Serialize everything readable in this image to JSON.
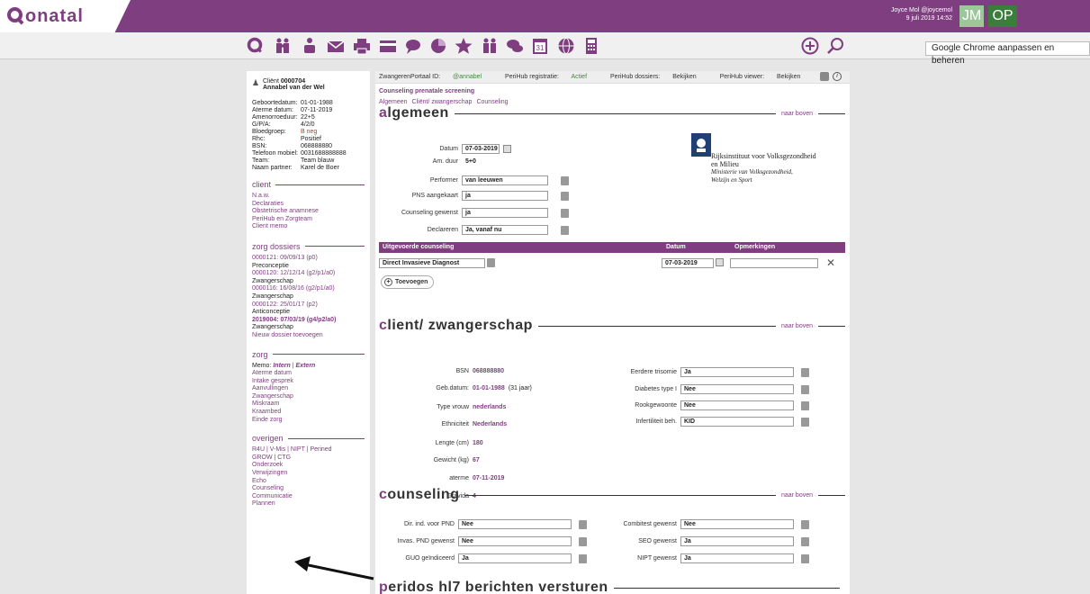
{
  "app": {
    "logo": "onatal"
  },
  "user": {
    "name": "Joyce Mol @joycemol",
    "datetime": "9 juli 2019 14:52",
    "avatar1": "JM",
    "avatar2": "OP"
  },
  "chrome_tooltip": "Google Chrome aanpassen en beheren",
  "toolbar": {
    "icons": [
      "search-icon",
      "family-icon",
      "baby-icon",
      "mail-icon",
      "print-icon",
      "card-icon",
      "chat-icon",
      "chart-icon",
      "star-icon",
      "family-icon",
      "conversation-icon",
      "calendar-icon",
      "globe-icon",
      "calculator-icon"
    ],
    "calendar_day": "31",
    "add": "+",
    "search": "search"
  },
  "sidebar": {
    "client_label": "Cliënt",
    "client_id": "0000704",
    "client_name": "Annabel van der Wel",
    "info": [
      [
        "Geboortedatum:",
        "01-01-1988"
      ],
      [
        "Aterme datum:",
        "07-11-2019"
      ],
      [
        "Amenorroeduur:",
        "22+5"
      ],
      [
        "G/P/A:",
        "4/2/0"
      ],
      [
        "Bloedgroep:",
        "B neg"
      ],
      [
        "Rhc:",
        "Positief"
      ],
      [
        "BSN:",
        "068888880"
      ],
      [
        "Telefoon mobiel:",
        "0031688888888"
      ],
      [
        "Team:",
        "Team blauw"
      ],
      [
        "Naam partner:",
        "Karel de Boer"
      ]
    ],
    "sec_client": "client",
    "client_links": [
      "N.a.w.",
      "Declaraties",
      "Obstetrische anamnese",
      "PeriHub en Zorgteam",
      "Client memo"
    ],
    "sec_dossiers": "zorg dossiers",
    "dossiers": [
      [
        "0000121: 09/09/13 (p0)",
        "Preconceptie"
      ],
      [
        "0000120: 12/12/14 (g2/p1/a0)",
        "Zwangerschap"
      ],
      [
        "0000116: 16/08/16 (g2/p1/a0)",
        "Zwangerschap"
      ],
      [
        "0000122: 25/01/17 (p2)",
        "Anticonceptie"
      ],
      [
        "2019004: 07/03/19 (g4/p2/a0)",
        "Zwangerschap"
      ]
    ],
    "new_dossier": "Nieuw dossier toevoegen",
    "sec_zorg": "zorg",
    "memo_label": "Memo:",
    "memo_intern": "Intern",
    "memo_sep": " | ",
    "memo_extern": "Extern",
    "zorg_links": [
      "Aterme datum",
      "Intake gesprek",
      "Aanvullingen",
      "Zwangerschap",
      "Miskraam",
      "Kraambed",
      "Einde zorg"
    ],
    "sec_overigen": "overigen",
    "overigen_links": [
      "R4U | V-Mis | NIPT | Perined",
      "GROW | CTG",
      "Onderzoek",
      "Verwijzingen",
      "Echo",
      "Counseling",
      "Communicatie",
      "Plannen"
    ]
  },
  "infobar": {
    "portal_label": "ZwangerenPortaal ID:",
    "portal_id": "@annabel",
    "reg_label": "PeriHub registratie:",
    "reg_val": "Actief",
    "dossiers_label": "PeriHub dossiers:",
    "dossiers_val": "Bekijken",
    "viewer_label": "PeriHub viewer:",
    "viewer_val": "Bekijken"
  },
  "page": {
    "title": "Counseling prenatale screening",
    "crumbs": [
      "Algemeen",
      "Cliënt/ zwangerschap",
      "Counseling"
    ],
    "naar_boven": "naar boven"
  },
  "algemeen": {
    "title_first": "a",
    "title_rest": "lgemeen",
    "fields": [
      {
        "label": "Datum",
        "value": "07-03-2019"
      },
      {
        "label": "Am. duur",
        "value": "5+0"
      },
      {
        "label": "Performer",
        "value": "van leeuwen"
      },
      {
        "label": "PNS aangekaart",
        "value": "ja"
      },
      {
        "label": "Counseling gewenst",
        "value": "ja"
      },
      {
        "label": "Declareren",
        "value": "Ja, vanaf nu"
      }
    ],
    "rivm": {
      "name1": "Rijksinstituut voor Volksgezondheid",
      "name2": "en Milieu",
      "ministry1": "Ministerie van Volksgezondheid,",
      "ministry2": "Welzijn en Sport"
    }
  },
  "counseling_table": {
    "headers": [
      "Uitgevoerde counseling",
      "Datum",
      "Opmerkingen"
    ],
    "row": {
      "type": "Direct Invasieve Diagnost",
      "date": "07-03-2019",
      "remark": ""
    },
    "add_label": "Toevoegen"
  },
  "client_section": {
    "title_first": "c",
    "title_rest": "lient/ zwangerschap",
    "left": [
      {
        "label": "BSN",
        "value": "068888880"
      },
      {
        "label": "Geb.datum:",
        "value": "01-01-1988",
        "extra": "(31 jaar)"
      },
      {
        "label": "Type vrouw",
        "value": "nederlands"
      },
      {
        "label": "Ethniciteit",
        "value": "Nederlands"
      },
      {
        "label": "Lengte (cm)",
        "value": "180"
      },
      {
        "label": "Gewicht (kg)",
        "value": "67"
      },
      {
        "label": "aterme",
        "value": "07-11-2019"
      },
      {
        "label": "Gravida",
        "value": "4"
      }
    ],
    "right": [
      {
        "label": "Eerdere trisomie",
        "value": "Ja"
      },
      {
        "label": "Diabetes type I",
        "value": "Nee"
      },
      {
        "label": "Rookgewoonte",
        "value": "Nee"
      },
      {
        "label": "Infertiliteit beh.",
        "value": "KID"
      }
    ]
  },
  "counseling_section": {
    "title_first": "c",
    "title_rest": "ounseling",
    "left": [
      {
        "label": "Dir. ind. voor PND",
        "value": "Nee"
      },
      {
        "label": "Invas. PND gewenst",
        "value": "Nee"
      },
      {
        "label": "GUO geïndiceerd",
        "value": "Ja"
      }
    ],
    "right": [
      {
        "label": "Combitest gewenst",
        "value": "Nee"
      },
      {
        "label": "SEO gewenst",
        "value": "Ja"
      },
      {
        "label": "NIPT gewenst",
        "value": "Ja"
      }
    ]
  },
  "peridos": {
    "title_first": "p",
    "title_rest": "eridos hl7 berichten versturen"
  }
}
